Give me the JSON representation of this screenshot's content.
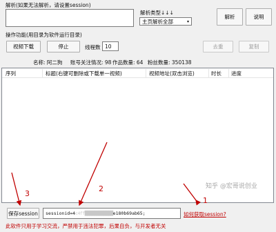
{
  "parse_section": {
    "label": "解析(如果无法解析，请设置session)",
    "url_value": "",
    "type_label": "解析类型↓↓↓",
    "type_selected": "主页解析全部",
    "parse_button": "解析",
    "help_button": "说明"
  },
  "operation": {
    "label": "操作功能(用目录为软件运行目录)",
    "download_button": "视频下载",
    "stop_button": "停止",
    "threads_label": "线程数",
    "threads_value": "10",
    "dedup_button": "去重",
    "copy_button": "复制"
  },
  "info_bar": {
    "name": "名称: 阿二狗",
    "follow": "账号关注情况: 98",
    "works": "作品数量: 64",
    "fans": "粉丝数量: 350138"
  },
  "table": {
    "columns": [
      "序列",
      "标题(右键可删除或下载单一视频)",
      "视频地址(双击浏览)",
      "时长",
      "进度"
    ]
  },
  "session": {
    "save_button": "保存session",
    "value_prefix": "sessionid=4",
    "value_blurred": "c4ff████████████",
    "value_suffix": "e180b69ab65;",
    "how_to_link": "如何获取session?"
  },
  "annotations": [
    "1",
    "2",
    "3"
  ],
  "watermark": "知乎 @宏哥说创业",
  "disclaimer": "此软件只用于学习交流，严禁用于违法犯罪，后果自负，与开发者无关"
}
